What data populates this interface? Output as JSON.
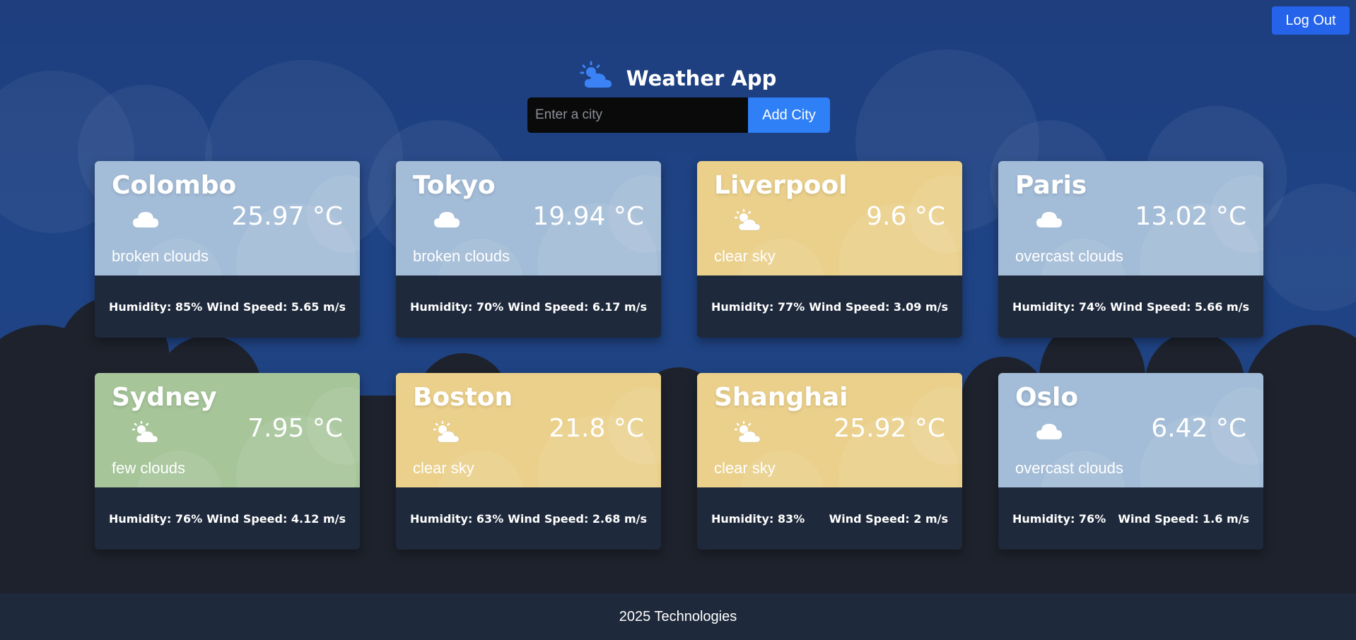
{
  "header": {
    "logout_label": "Log Out",
    "app_title": "Weather App",
    "app_icon": "partly-cloudy-icon"
  },
  "search": {
    "placeholder": "Enter a city",
    "value": "",
    "add_label": "Add City"
  },
  "cards": [
    {
      "city": "Colombo",
      "temp": "25.97 °C",
      "description": "broken clouds",
      "humidity": "Humidity: 85%",
      "wind": "Wind Speed: 5.65 m/s",
      "icon": "cloud-icon",
      "theme": "cloudy"
    },
    {
      "city": "Tokyo",
      "temp": "19.94 °C",
      "description": "broken clouds",
      "humidity": "Humidity: 70%",
      "wind": "Wind Speed: 6.17 m/s",
      "icon": "cloud-icon",
      "theme": "cloudy"
    },
    {
      "city": "Liverpool",
      "temp": "9.6 °C",
      "description": "clear sky",
      "humidity": "Humidity: 77%",
      "wind": "Wind Speed: 3.09 m/s",
      "icon": "sun-cloud-icon",
      "theme": "sunny"
    },
    {
      "city": "Paris",
      "temp": "13.02 °C",
      "description": "overcast clouds",
      "humidity": "Humidity: 74%",
      "wind": "Wind Speed: 5.66 m/s",
      "icon": "cloud-icon",
      "theme": "cloudy"
    },
    {
      "city": "Sydney",
      "temp": "7.95 °C",
      "description": "few clouds",
      "humidity": "Humidity: 76%",
      "wind": "Wind Speed: 4.12 m/s",
      "icon": "sun-cloud-icon",
      "theme": "green"
    },
    {
      "city": "Boston",
      "temp": "21.8 °C",
      "description": "clear sky",
      "humidity": "Humidity: 63%",
      "wind": "Wind Speed: 2.68 m/s",
      "icon": "sun-cloud-icon",
      "theme": "sunny"
    },
    {
      "city": "Shanghai",
      "temp": "25.92 °C",
      "description": "clear sky",
      "humidity": "Humidity: 83%",
      "wind": "Wind Speed: 2 m/s",
      "icon": "sun-cloud-icon",
      "theme": "sunny"
    },
    {
      "city": "Oslo",
      "temp": "6.42 °C",
      "description": "overcast clouds",
      "humidity": "Humidity: 76%",
      "wind": "Wind Speed: 1.6 m/s",
      "icon": "cloud-icon",
      "theme": "cloudy"
    }
  ],
  "footer": {
    "text": "2025 Technologies"
  },
  "colors": {
    "accent": "#2563eb",
    "cloudy": "#a3bcd7",
    "sunny": "#ead08b",
    "green": "#a6c599",
    "card_bottom": "#1e293b"
  }
}
